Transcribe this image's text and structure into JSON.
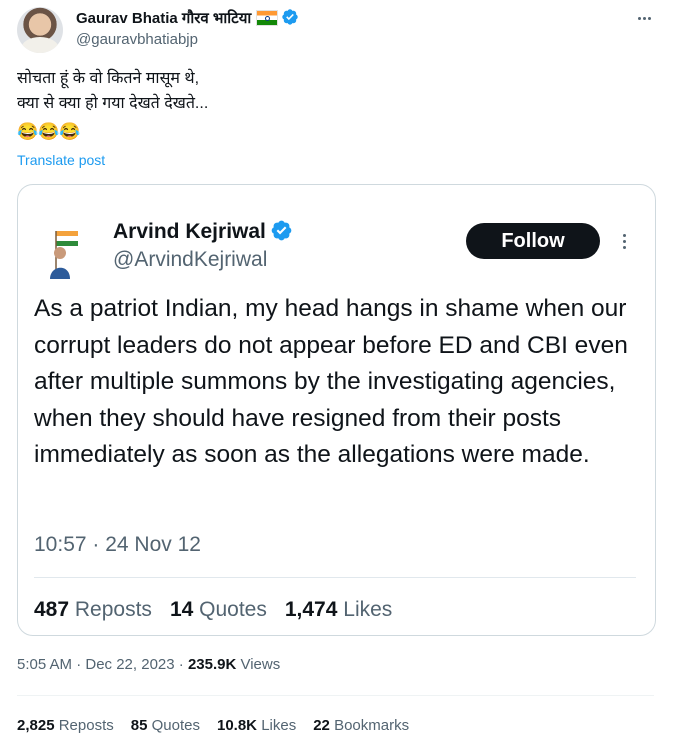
{
  "post": {
    "author_name": "Gaurav Bhatia गौरव भाटिया",
    "author_handle": "@gauravbhatiabjp",
    "text": "सोचता हूं के वो कितने मासूम थे,\nक्या से क्या हो गया देखते देखते...",
    "emojis": "😂😂😂",
    "translate_label": "Translate post",
    "timestamp": "5:05 AM · Dec 22, 2023 ·",
    "views_count": "235.9K",
    "views_label": "Views"
  },
  "quote": {
    "author_name": "Arvind Kejriwal",
    "author_handle": "@ArvindKejriwal",
    "follow_label": "Follow",
    "text": "As a patriot Indian, my head hangs in shame when our corrupt leaders do not appear before ED and CBI even after multiple summons by the investigating agencies, when they should have resigned from their posts immediately as soon as the allegations were made.",
    "timestamp": "10:57 · 24 Nov 12",
    "reposts_count": "487",
    "reposts_label": "Reposts",
    "quotes_count": "14",
    "quotes_label": "Quotes",
    "likes_count": "1,474",
    "likes_label": "Likes"
  },
  "engagement": {
    "reposts_count": "2,825",
    "reposts_label": "Reposts",
    "quotes_count": "85",
    "quotes_label": "Quotes",
    "likes_count": "10.8K",
    "likes_label": "Likes",
    "bookmarks_count": "22",
    "bookmarks_label": "Bookmarks"
  },
  "colors": {
    "link": "#1d9bf0",
    "secondary_text": "#536471",
    "verified": "#1d9bf0",
    "follow_button": "#0f1419"
  },
  "icons": [
    "verified-badge-icon",
    "india-flag-icon",
    "more-options-icon"
  ]
}
